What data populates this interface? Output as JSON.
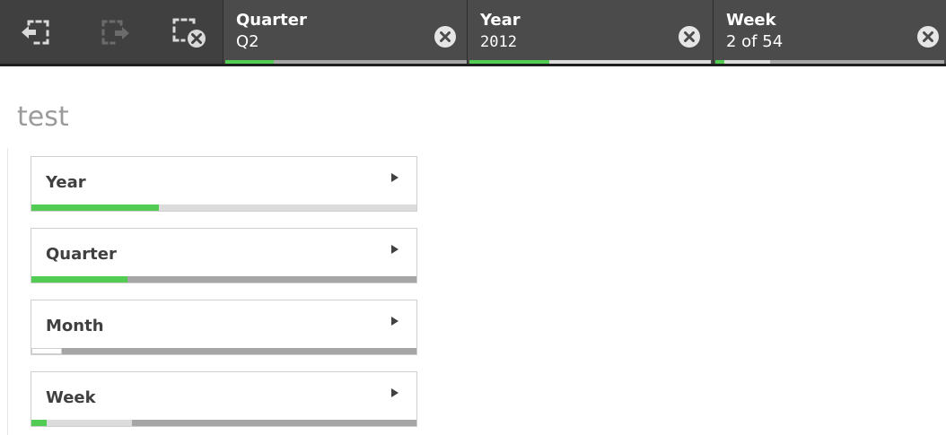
{
  "toolbar": {
    "tools": [
      {
        "name": "step-back",
        "enabled": true
      },
      {
        "name": "step-forward",
        "enabled": false
      },
      {
        "name": "clear-all",
        "enabled": true
      }
    ],
    "chips": [
      {
        "field": "Quarter",
        "value": "Q2",
        "mono": false,
        "segments": [
          {
            "kind": "selected",
            "fraction": 0.2
          },
          {
            "kind": "excluded",
            "fraction": 0.8
          }
        ]
      },
      {
        "field": "Year",
        "value": "2012",
        "mono": true,
        "segments": [
          {
            "kind": "selected",
            "fraction": 0.33
          },
          {
            "kind": "alternative",
            "fraction": 0.67
          }
        ]
      },
      {
        "field": "Week",
        "value": "2 of 54",
        "mono": false,
        "segments": [
          {
            "kind": "selected",
            "fraction": 0.04
          },
          {
            "kind": "alternative",
            "fraction": 0.2
          },
          {
            "kind": "excluded",
            "fraction": 0.76
          }
        ]
      }
    ]
  },
  "sheet": {
    "title": "test"
  },
  "listboxes": [
    {
      "label": "Year",
      "segments": [
        {
          "kind": "selected",
          "fraction": 0.33
        },
        {
          "kind": "alternative",
          "fraction": 0.67
        }
      ]
    },
    {
      "label": "Quarter",
      "segments": [
        {
          "kind": "selected",
          "fraction": 0.25
        },
        {
          "kind": "excluded",
          "fraction": 0.75
        }
      ]
    },
    {
      "label": "Month",
      "segments": [
        {
          "kind": "possible",
          "fraction": 0.08
        },
        {
          "kind": "excluded",
          "fraction": 0.92
        }
      ]
    },
    {
      "label": "Week",
      "segments": [
        {
          "kind": "selected",
          "fraction": 0.04
        },
        {
          "kind": "alternative",
          "fraction": 0.22
        },
        {
          "kind": "excluded",
          "fraction": 0.74
        }
      ]
    }
  ],
  "colors": {
    "selected": "#52cc52",
    "alternative": "#dcdcdc",
    "excluded": "#a6a6a6",
    "possible": "#ffffff",
    "toolbar_bg": "#404040",
    "chip_bg": "#4b4b4b"
  }
}
